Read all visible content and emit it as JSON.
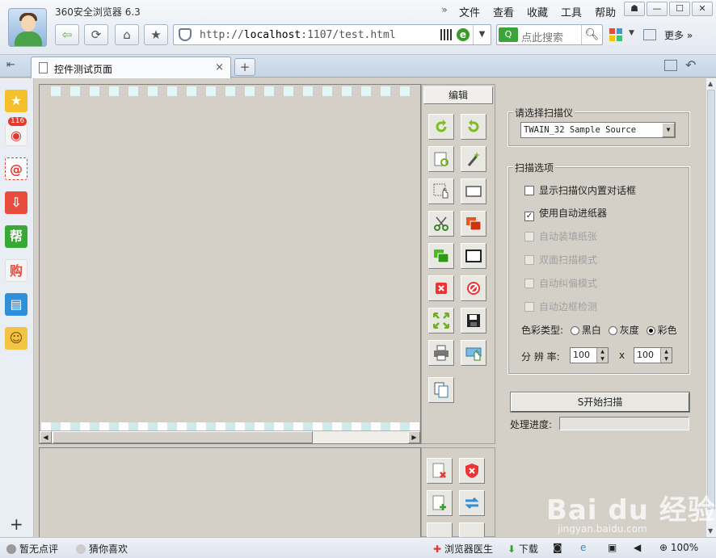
{
  "window": {
    "title": "360安全浏览器 6.3",
    "menu": [
      "文件",
      "查看",
      "收藏",
      "工具",
      "帮助"
    ],
    "more": "更多"
  },
  "nav": {
    "url_prefix": "http://",
    "url_host": "localhost",
    "url_rest": ":1107/test.html",
    "search_placeholder": "点此搜索"
  },
  "tab": {
    "label": "控件测试页面",
    "close": "×",
    "new": "+"
  },
  "sidebar": {
    "weibo_badge": "116",
    "help_label": "帮",
    "shop_label": "购"
  },
  "edit_panel": {
    "header": "编辑"
  },
  "scanner": {
    "legend": "请选择扫描仪",
    "selected": "TWAIN_32 Sample Source"
  },
  "options": {
    "legend": "扫描选项",
    "items": [
      {
        "label": "显示扫描仪内置对话框",
        "checked": false,
        "enabled": true
      },
      {
        "label": "使用自动进纸器",
        "checked": true,
        "enabled": true
      },
      {
        "label": "自动装填纸张",
        "checked": false,
        "enabled": false
      },
      {
        "label": "双面扫描模式",
        "checked": false,
        "enabled": false
      },
      {
        "label": "自动纠偏模式",
        "checked": false,
        "enabled": false
      },
      {
        "label": "自动边框检测",
        "checked": false,
        "enabled": false
      }
    ],
    "color_label": "色彩类型:",
    "color_options": [
      "黑白",
      "灰度",
      "彩色"
    ],
    "color_selected": 2,
    "resolution_label": "分 辨 率:",
    "res_x": "100",
    "res_sep": "x",
    "res_y": "100"
  },
  "scan": {
    "button": "S开始扫描",
    "progress_label": "处理进度:",
    "progress": 0
  },
  "status": {
    "rating": "暂无点评",
    "guess": "猜你喜欢",
    "doctor": "浏览器医生",
    "download": "下载",
    "zoom": "100%"
  },
  "watermark": {
    "brand": "Bai du 经验",
    "url": "jingyan.baidu.com"
  }
}
